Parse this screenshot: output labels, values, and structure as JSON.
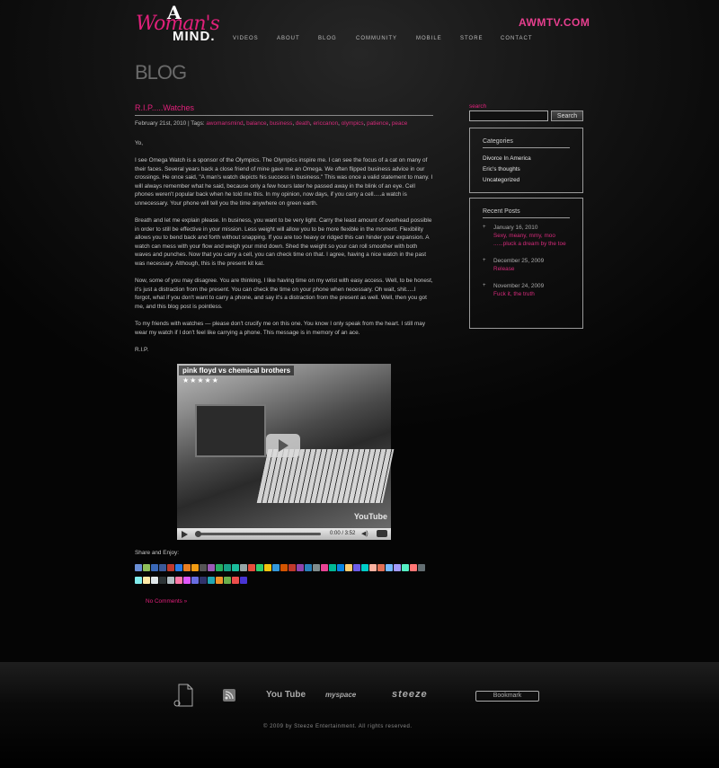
{
  "header": {
    "logo": {
      "line1": "A",
      "line2": "Woman's",
      "line3": "MIND."
    },
    "site_url": "AWMTV.COM",
    "nav": [
      "VIDEOS",
      "ABOUT",
      "BLOG",
      "COMMUNITY",
      "MOBILE",
      "STORE",
      "CONTACT"
    ]
  },
  "page_title": "BLOG",
  "post": {
    "title": "R.I.P.....Watches",
    "date_and_tags_label": "February 21st, 2010 | Tags:",
    "tags": [
      "awomansmind",
      "balance",
      "business",
      "death",
      "ericcanon",
      "olympics",
      "patience",
      "peace"
    ],
    "paragraphs": [
      "Yo,",
      "I see Omega Watch is a sponsor of the Olympics.  The Olympics inspire me.  I can see the focus of a cat on many of their faces.  Several years back a close friend of mine gave me an Omega.  We often flipped business advice in our crossings.   He once said, \"A man's watch depicts his success in business.\"  This was once a valid statement to many.  I will always remember what he said, because only a few hours later he passed away in the blink of an eye.  Cell phones weren't popular back when he told me this.  In my opinion, now days, if you carry a cell.....a watch is unnecessary.  Your phone will tell you the time anywhere on green earth.",
      "Breath and let me explain please.  In business, you want to be very light.  Carry the least amount of overhead possible in order to still be effective in your mission.  Less weight will allow you to be more flexible in the moment.  Flexibility allows you to bend back and forth without snapping.  If you are too heavy or ridged this can hinder your expansion.  A watch can mess with your flow and weigh your mind down.  Shed the weight so your can roll smoother with both waves and punches.  Now that you carry a cell, you can check time on that.  I agree, having a nice watch in the past was necessary.  Although, this is the present kit kat.",
      "Now, some of you may disagree.  You are thinking, I like having time on my wrist with easy access.  Well, to be honest, it's just a distraction from the present.  You can check the time on your phone when necessary.  Oh wait, shit.....I forgot, what if you don't want to carry a phone, and say it's a distraction from the present as well.  Well, then you got me, and this blog post is pointless.",
      "To my friends with watches — please don't crucify me on this one.  You know I only speak from the heart.  I still may wear my watch if I don't feel like carrying a phone.  This message is in memory of an ace.",
      "R.I.P."
    ],
    "video": {
      "title": "pink floyd vs chemical brothers",
      "stars": "★★★★★",
      "time": "0:00 / 3:52",
      "watermark": "YouTube",
      "progress": 0.0
    },
    "share_label": "Share and Enjoy:",
    "share_icon_colors": [
      "#6a8fd6",
      "#8fbf5a",
      "#3a68b8",
      "#3b5998",
      "#c0392b",
      "#2a7ae2",
      "#e67e22",
      "#f39c12",
      "#555",
      "#9b59b6",
      "#27ae60",
      "#16a085",
      "#1abc9c",
      "#95a5a6",
      "#e74c3c",
      "#2ecc71",
      "#f1c40f",
      "#3498db",
      "#d35400",
      "#c0392b",
      "#8e44ad",
      "#2980b9",
      "#7f8c8d",
      "#e84393",
      "#00b894",
      "#0984e3",
      "#fdcb6e",
      "#6c5ce7",
      "#00cec9",
      "#fab1a0",
      "#e17055",
      "#74b9ff",
      "#a29bfe",
      "#55efc4",
      "#ff7675",
      "#636e72",
      "#81ecec",
      "#ffeaa7",
      "#dfe6e9",
      "#2d3436",
      "#b2bec3",
      "#fd79a8",
      "#e056fd",
      "#686de0",
      "#30336b",
      "#22a6b3",
      "#f0932b",
      "#6ab04c",
      "#eb4d4b",
      "#4834d4"
    ],
    "comments_link": "No Comments »"
  },
  "sidebar": {
    "search_label": "search",
    "search_value": "",
    "search_button": "Search",
    "categories": {
      "title": "Categories",
      "items": [
        "Divorce In America",
        "Eric's thoughts",
        "Uncategorized"
      ]
    },
    "recent": {
      "title": "Recent Posts",
      "items": [
        {
          "date": "January 16, 2010",
          "title": "Sexy, meany, mmy, moo ......pluck a dream by the toe"
        },
        {
          "date": "December 25, 2009",
          "title": "Release"
        },
        {
          "date": "November 24, 2009",
          "title": "Fuck it, the truth"
        }
      ]
    }
  },
  "footer": {
    "youtube": "You Tube",
    "myspace": "myspace",
    "steeze": "steeze",
    "bookmark": "Bookmark",
    "copyright": "© 2009 by Steeze Entertainment.  All rights reserved."
  },
  "colors": {
    "accent": "#e0207a",
    "background": "#000000"
  }
}
